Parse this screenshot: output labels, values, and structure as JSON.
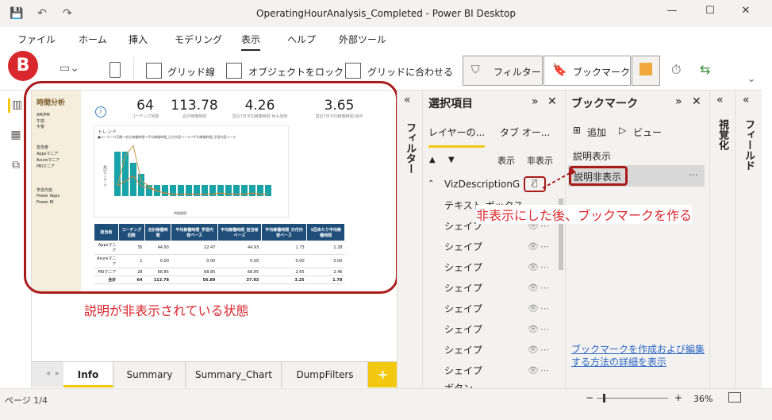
{
  "window": {
    "title": "OperatingHourAnalysis_Completed - Power BI Desktop"
  },
  "menu": [
    "ファイル",
    "ホーム",
    "挿入",
    "モデリング",
    "表示",
    "ヘルプ",
    "外部ツール"
  ],
  "ribbon": {
    "gridlines": "グリッド線",
    "lock_objects": "オブジェクトをロック",
    "snap_to_grid": "グリッドに合わせる",
    "filters": "フィルター",
    "bookmarks": "ブックマーク"
  },
  "report": {
    "side_title": "時間分析",
    "ampm_label": "AM/PM",
    "ampm_opts": [
      "午前",
      "午後"
    ],
    "owner_label": "担当者",
    "owner_opts": [
      "Appsマニア",
      "Azureマニア",
      "PBIマニア"
    ],
    "study_label": "学習内容",
    "study_opts": [
      "Power Apps",
      "Power BI"
    ],
    "kpis": [
      {
        "value": "64",
        "label": "コーチング回数"
      },
      {
        "value": "113.78",
        "label": "合計稼働時間"
      },
      {
        "value": "4.26",
        "label": "直近7日平均稼働時間 休み加味"
      },
      {
        "value": "3.65",
        "label": "直近7日平均稼働時間 除外"
      }
    ],
    "trend_title": "トレンド",
    "trend_legend": "■コーチング回数 ━合計稼働時間 ━平均稼働時間_日付内容ベース ━平均稼働時間_学習内容ベース",
    "trend_xlabel": "時間間隔",
    "trend_ylabel": "コーチング回数",
    "table": {
      "headers": [
        "担当者",
        "コーチング回数",
        "合計稼働時間",
        "平均稼働時間_学習内容ベース",
        "平均稼働時間_担当者ベース",
        "平均稼働時間_日付内容ベース",
        "1回あたり平均稼働時間"
      ],
      "rows": [
        [
          "Appsマニア",
          "35",
          "44.93",
          "22.47",
          "44.93",
          "1.73",
          "1.28"
        ],
        [
          "Azureマニア",
          "1",
          "0.00",
          "0.00",
          "0.00",
          "0.00",
          "0.00"
        ],
        [
          "PBIマニア",
          "28",
          "68.85",
          "68.85",
          "68.85",
          "2.65",
          "2.46"
        ],
        [
          "合計",
          "64",
          "113.78",
          "56.89",
          "37.93",
          "3.25",
          "1.78"
        ]
      ]
    }
  },
  "selection_pane": {
    "title": "選択項目",
    "tab1": "レイヤーの...",
    "tab2": "タブ オー...",
    "show": "表示",
    "hide": "非表示",
    "group": "VizDescriptionG",
    "items": [
      "テキスト ボックス",
      "シェイプ",
      "シェイプ",
      "シェイプ",
      "シェイプ",
      "シェイプ",
      "シェイプ",
      "シェイプ",
      "シェイプ",
      "ボタン"
    ]
  },
  "bookmark_pane": {
    "title": "ブックマーク",
    "add": "追加",
    "view": "ビュー",
    "items": [
      "説明表示",
      "説明非表示"
    ],
    "help_link": "ブックマークを作成および編集する方法の詳細を表示"
  },
  "collapsed": {
    "filters": "フィルター",
    "visualizations": "視覚化",
    "fields": "フィールド"
  },
  "tabs": [
    "Info",
    "Summary",
    "Summary_Chart",
    "DumpFilters",
    "+"
  ],
  "status": {
    "page": "ページ 1/4",
    "zoom": "36%"
  },
  "annotations": {
    "badge": "B",
    "callout_top": "非表示にした後、ブックマークを作る",
    "callout_bottom": "説明が非表示されている状態"
  },
  "chart_data": {
    "type": "bar",
    "series": [
      {
        "name": "コーチング回数",
        "values": [
          4,
          4,
          3,
          2,
          1,
          1,
          1,
          1,
          1,
          1,
          1,
          1,
          1,
          1,
          1,
          1,
          1,
          1,
          1,
          1
        ]
      },
      {
        "name": "合計稼働時間",
        "values": [
          10,
          40,
          50,
          15,
          10,
          5,
          3,
          2,
          2,
          2,
          2,
          2,
          2,
          3,
          2,
          2,
          2,
          3,
          2,
          2
        ]
      },
      {
        "name": "平均稼働時間_日付内容ベース",
        "values": [
          10,
          15,
          20,
          10,
          8,
          5,
          3,
          2,
          2,
          2,
          2,
          2,
          2,
          3,
          2,
          2,
          2,
          3,
          2,
          2
        ]
      }
    ]
  }
}
